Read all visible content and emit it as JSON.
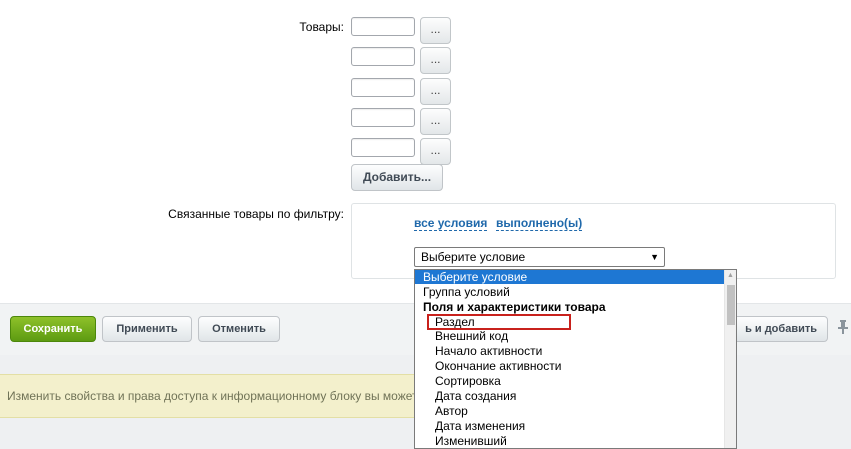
{
  "form": {
    "products_label": "Товары:",
    "product_picker_label": "...",
    "add_button": "Добавить...",
    "related_filter_label": "Связанные товары по фильтру:",
    "link_all_conditions": "все условия",
    "link_fulfilled": "выполнено(ы)",
    "condition_select_value": "Выберите условие"
  },
  "footer": {
    "save": "Сохранить",
    "apply": "Применить",
    "cancel": "Отменить",
    "save_and_add": "ь и добавить"
  },
  "info_banner": "Изменить свойства и права доступа к информационному блоку вы можете",
  "dropdown": {
    "options": [
      "Выберите условие",
      "Группа условий",
      "Поля и характеристики товара",
      "Раздел",
      "Внешний код",
      "Начало активности",
      "Окончание активности",
      "Сортировка",
      "Дата создания",
      "Автор",
      "Дата изменения",
      "Изменивший"
    ],
    "selected_index": 0,
    "group_header_index": 2,
    "highlighted_index": 3
  },
  "colors": {
    "link": "#2069ab",
    "save_button": "#6aa61a",
    "selected_option_bg": "#1e77d3",
    "highlight_border": "#c8211c",
    "banner_bg": "#f3f0cc"
  }
}
